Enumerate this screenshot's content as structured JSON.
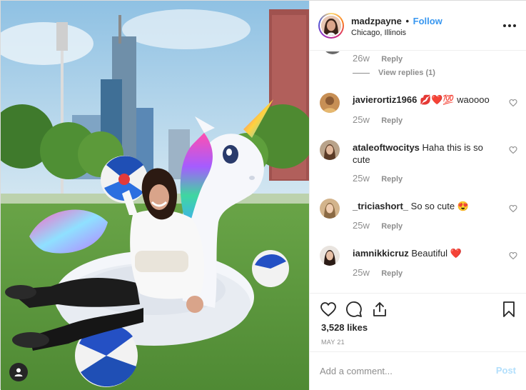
{
  "photo": {
    "alt_icon": "user-tag-icon"
  },
  "header": {
    "username": "madzpayne",
    "separator": "•",
    "follow_label": "Follow",
    "location": "Chicago, Illinois",
    "more_icon": "more-horizontal-icon"
  },
  "comments": {
    "first_partial": {
      "time": "26w",
      "reply_label": "Reply",
      "view_replies": "View replies (1)"
    },
    "items": [
      {
        "username": "javierortiz1966",
        "text": "💋❤️💯 waoooo",
        "time": "25w",
        "reply_label": "Reply"
      },
      {
        "username": "ataleoftwocitys",
        "text": "Haha this is so cute",
        "time": "25w",
        "reply_label": "Reply"
      },
      {
        "username": "_triciashort_",
        "text": "So so cute 😍",
        "time": "25w",
        "reply_label": "Reply"
      },
      {
        "username": "iamnikkicruz",
        "text": "Beautiful ❤️",
        "time": "25w",
        "reply_label": "Reply"
      }
    ]
  },
  "actions": {
    "like_icon": "heart-icon",
    "comment_icon": "comment-bubble-icon",
    "share_icon": "share-upload-icon",
    "save_icon": "bookmark-icon",
    "likes_text": "3,528 likes",
    "date": "MAY 21"
  },
  "composer": {
    "placeholder": "Add a comment...",
    "post_label": "Post"
  },
  "colors": {
    "accent": "#3897f0",
    "post_disabled": "#b2dffc",
    "muted": "#8e8e8e",
    "text": "#262626"
  }
}
